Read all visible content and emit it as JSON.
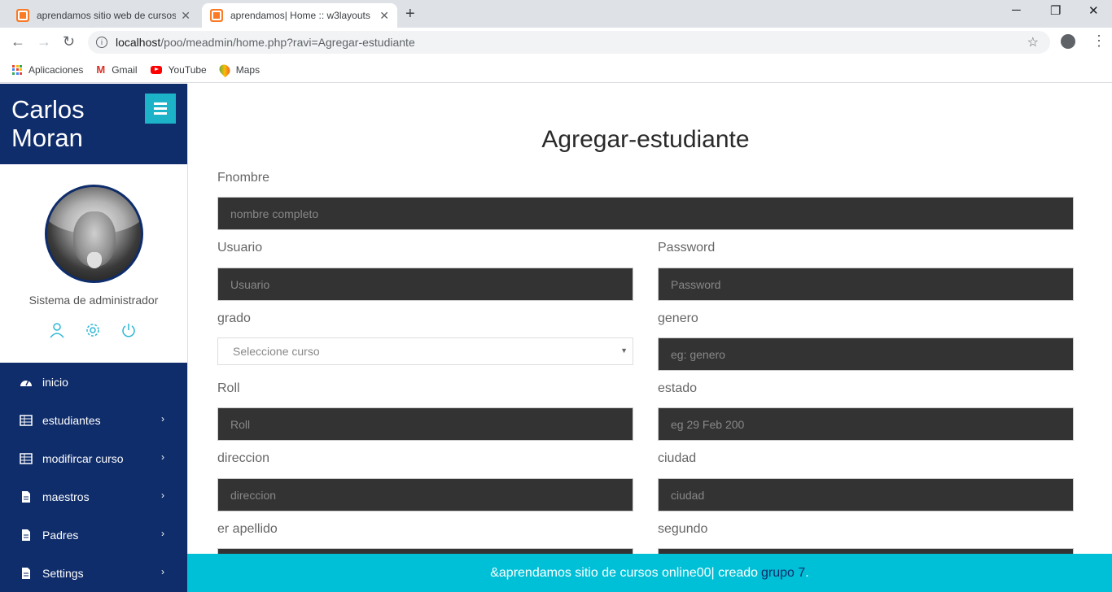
{
  "browser": {
    "tabs": [
      {
        "title": "aprendamos sitio web de cursos"
      },
      {
        "title": "aprendamos| Home :: w3layouts"
      }
    ],
    "url_host": "localhost",
    "url_path": "/poo/meadmin/home.php?ravi=Agregar-estudiante",
    "bookmarks": [
      {
        "label": "Aplicaciones",
        "icon": "apps-grid-icon"
      },
      {
        "label": "Gmail",
        "icon": "gmail-icon"
      },
      {
        "label": "YouTube",
        "icon": "youtube-icon"
      },
      {
        "label": "Maps",
        "icon": "maps-icon"
      }
    ]
  },
  "sidebar": {
    "brand": "Carlos Moran",
    "role": "Sistema de administrador",
    "items": [
      {
        "label": "inicio",
        "icon": "dashboard-icon"
      },
      {
        "label": "estudiantes",
        "icon": "table-icon"
      },
      {
        "label": "modifircar curso",
        "icon": "table-icon"
      },
      {
        "label": "maestros",
        "icon": "file-icon"
      },
      {
        "label": "Padres",
        "icon": "file-icon"
      },
      {
        "label": "Settings",
        "icon": "file-icon"
      }
    ]
  },
  "main": {
    "title": "Agregar-estudiante",
    "fields": {
      "fnombre": {
        "label": "Fnombre",
        "placeholder": "nombre completo"
      },
      "usuario": {
        "label": "Usuario",
        "placeholder": "Usuario"
      },
      "password": {
        "label": "Password",
        "placeholder": "Password"
      },
      "grado": {
        "label": "grado",
        "value": "Seleccione curso"
      },
      "genero": {
        "label": "genero",
        "placeholder": "eg: genero"
      },
      "roll": {
        "label": "Roll",
        "placeholder": "Roll"
      },
      "estado": {
        "label": "estado",
        "placeholder": "eg 29 Feb 200"
      },
      "direccion": {
        "label": "direccion",
        "placeholder": "direccion"
      },
      "ciudad": {
        "label": "ciudad",
        "placeholder": "ciudad"
      },
      "apellido": {
        "label": "er apellido"
      },
      "segundo": {
        "label": "segundo"
      }
    }
  },
  "footer": {
    "text": "&aprendamos sitio de cursos online00| creado",
    "link": "grupo 7",
    "suffix": "."
  },
  "colors": {
    "sidebar": "#0f2d6b",
    "accent": "#00c0d7",
    "input_bg": "#333333"
  }
}
